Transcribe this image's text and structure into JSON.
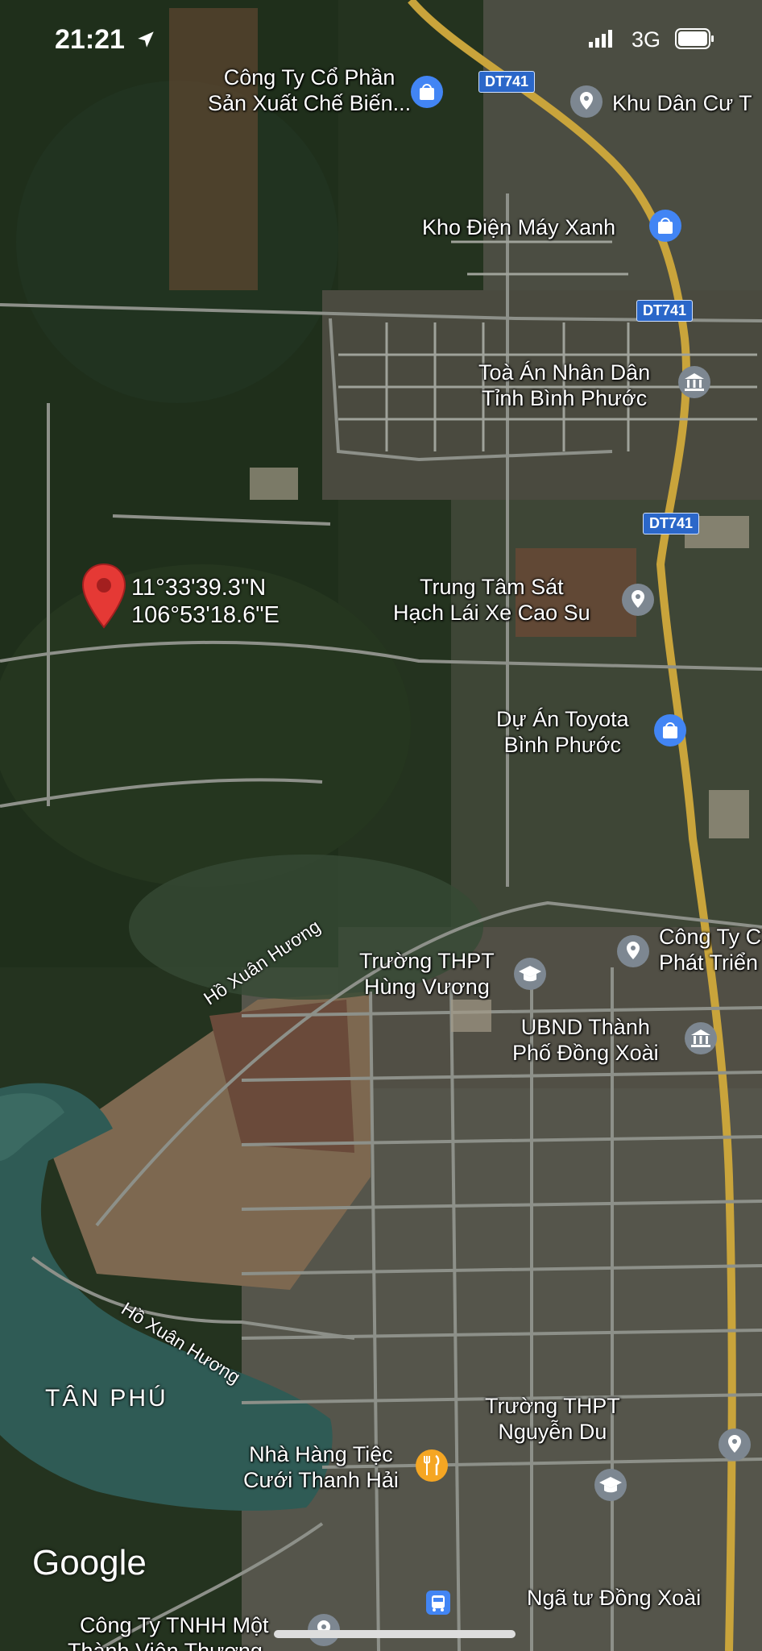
{
  "status_bar": {
    "time": "21:21",
    "network": "3G"
  },
  "map": {
    "provider": "Google",
    "dropped_pin": {
      "lat": "11°33'39.3\"N",
      "lng": "106°53'18.6\"E"
    },
    "road_shields": [
      "DT741",
      "DT741",
      "DT741"
    ],
    "places": [
      {
        "name_line1": "Công Ty Cổ Phần",
        "name_line2": "Sản Xuất Chế Biến...",
        "icon": "shopping-bag-icon"
      },
      {
        "name_line1": "Khu Dân Cư T",
        "icon": "location-pin-icon"
      },
      {
        "name_line1": "Kho Điện Máy Xanh",
        "icon": "shopping-bag-icon"
      },
      {
        "name_line1": "Toà Án Nhân Dân",
        "name_line2": "Tỉnh Bình Phước",
        "icon": "government-building-icon"
      },
      {
        "name_line1": "Trung Tâm Sát",
        "name_line2": "Hạch Lái Xe Cao Su",
        "icon": "location-pin-icon"
      },
      {
        "name_line1": "Dự Án Toyota",
        "name_line2": "Bình Phước",
        "icon": "shopping-bag-icon"
      },
      {
        "name_line1": "Công Ty C",
        "name_line2": "Phát Triển",
        "icon": "location-pin-icon"
      },
      {
        "name_line1": "Trường THPT",
        "name_line2": "Hùng Vương",
        "icon": "school-icon"
      },
      {
        "name_line1": "UBND Thành",
        "name_line2": "Phố Đồng Xoài",
        "icon": "government-building-icon"
      },
      {
        "name_line1": "Trường THPT",
        "name_line2": "Nguyễn Du",
        "icon": "school-icon"
      },
      {
        "name_line1": "Nhà Hàng Tiệc",
        "name_line2": "Cưới Thanh Hải",
        "icon": "restaurant-icon"
      },
      {
        "name_line1": "Ngã tư Đồng Xoài",
        "icon": "bus-stop-icon"
      },
      {
        "name_line1": "Công Ty TNHH Một",
        "name_line2": "Thành Viên Thương...",
        "icon": "location-pin-icon"
      }
    ],
    "streets": [
      "Hồ Xuân Hương",
      "Hồ Xuân Hương"
    ],
    "areas": [
      "TÂN PHÚ"
    ],
    "colors": {
      "shield": "#2b67c9",
      "pin_red": "#e53935",
      "poi_blue": "#4285f4",
      "poi_gray": "#7d8791",
      "poi_orange": "#f5a623",
      "road_yellow": "#c9a43b"
    }
  }
}
